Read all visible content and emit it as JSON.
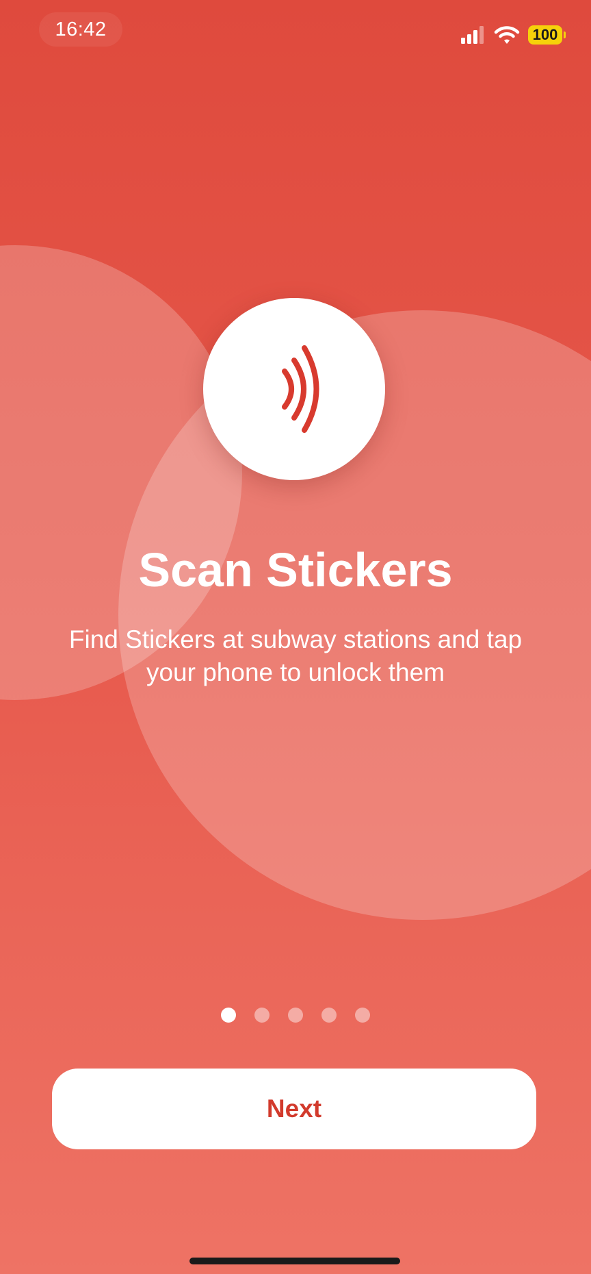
{
  "status_bar": {
    "time": "16:42",
    "battery": "100",
    "icons": [
      "cellular-signal-icon",
      "wifi-icon",
      "battery-icon"
    ]
  },
  "hero": {
    "icon": "nfc-waves-icon",
    "title": "Scan Stickers",
    "subtitle": "Find Stickers at subway stations and tap your phone to unlock them"
  },
  "pager": {
    "total": 5,
    "current": 1
  },
  "actions": {
    "next_label": "Next"
  },
  "colors": {
    "background_top": "#df4a3d",
    "background_bottom": "#ee7365",
    "accent": "#d23a2c",
    "battery": "#f6d20a"
  }
}
